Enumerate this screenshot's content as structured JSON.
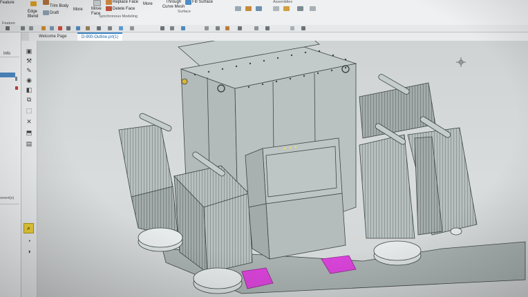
{
  "ribbon": {
    "feature_label": "Feature",
    "trim_body": "Trim Body",
    "draft": "Draft",
    "edge_blend": "Edge Blend",
    "more_1": "More",
    "move_face": "Move Face",
    "replace_face": "Replace Face",
    "delete_face": "Delete Face",
    "more_2": "More",
    "through_curve_mesh": "Through Curve Mesh",
    "fill_surface": "Fill Surface",
    "synchronous_modeling": "Synchronous Modeling",
    "surface": "Surface",
    "assemblies": "Assemblies",
    "feature_group": "Feature"
  },
  "tabs": {
    "welcome_page": "Welcome Page",
    "model_file": "D-900-Outline.prt(1)"
  },
  "left_panel": {
    "info_label": "Info",
    "fragment": "onent(s)"
  },
  "colors": {
    "housing": "#b9c1c1",
    "edge": "#3c4444",
    "magenta_pad": "#d944d9",
    "tab_accent": "#3a86c8"
  }
}
